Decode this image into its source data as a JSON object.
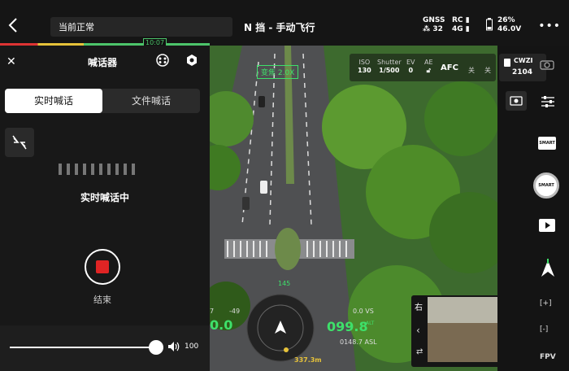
{
  "topbar": {
    "status": "当前正常",
    "title": "N 挡 - 手动飞行",
    "gnss_label": "GNSS",
    "gnss_value": "32",
    "rc_label": "RC",
    "rc_sub": "4G",
    "battery_percent": "26%",
    "battery_voltage": "46.0V",
    "progress_badge": "10:07"
  },
  "panel": {
    "title": "喊话器",
    "tabs": [
      {
        "label": "实时喊话",
        "active": true
      },
      {
        "label": "文件喊话",
        "active": false
      }
    ],
    "live_status": "实时喊话中",
    "end_label": "结束",
    "volume": "100",
    "volume_level": 1.0
  },
  "camera": {
    "zoom_label": "变焦 2.0X",
    "iso_label": "ISO",
    "iso_value": "130",
    "shutter_label": "Shutter",
    "shutter_value": "1/500",
    "ev_label": "EV",
    "ev_value": "0",
    "ae_label": "AE",
    "focus_mode": "AFC",
    "off1": "关",
    "off2": "关"
  },
  "hud": {
    "left_speed": "0.0",
    "left_scale_top": "7",
    "left_scale_val": "-49",
    "heading": "145",
    "vs_value": "0.0",
    "vs_label": "VS",
    "altitude": "099.8",
    "alt_label": "ALT",
    "asl": "0148.7 ASL",
    "distance": "337.3m"
  },
  "pip": {
    "direction": "右"
  },
  "right": {
    "storage_name": "CWZI",
    "storage_value": "2104",
    "smart_label": "SMART",
    "shutter_label": "SMART",
    "fpv_label": "FPV",
    "plus": "[+]",
    "minus": "[-]"
  }
}
